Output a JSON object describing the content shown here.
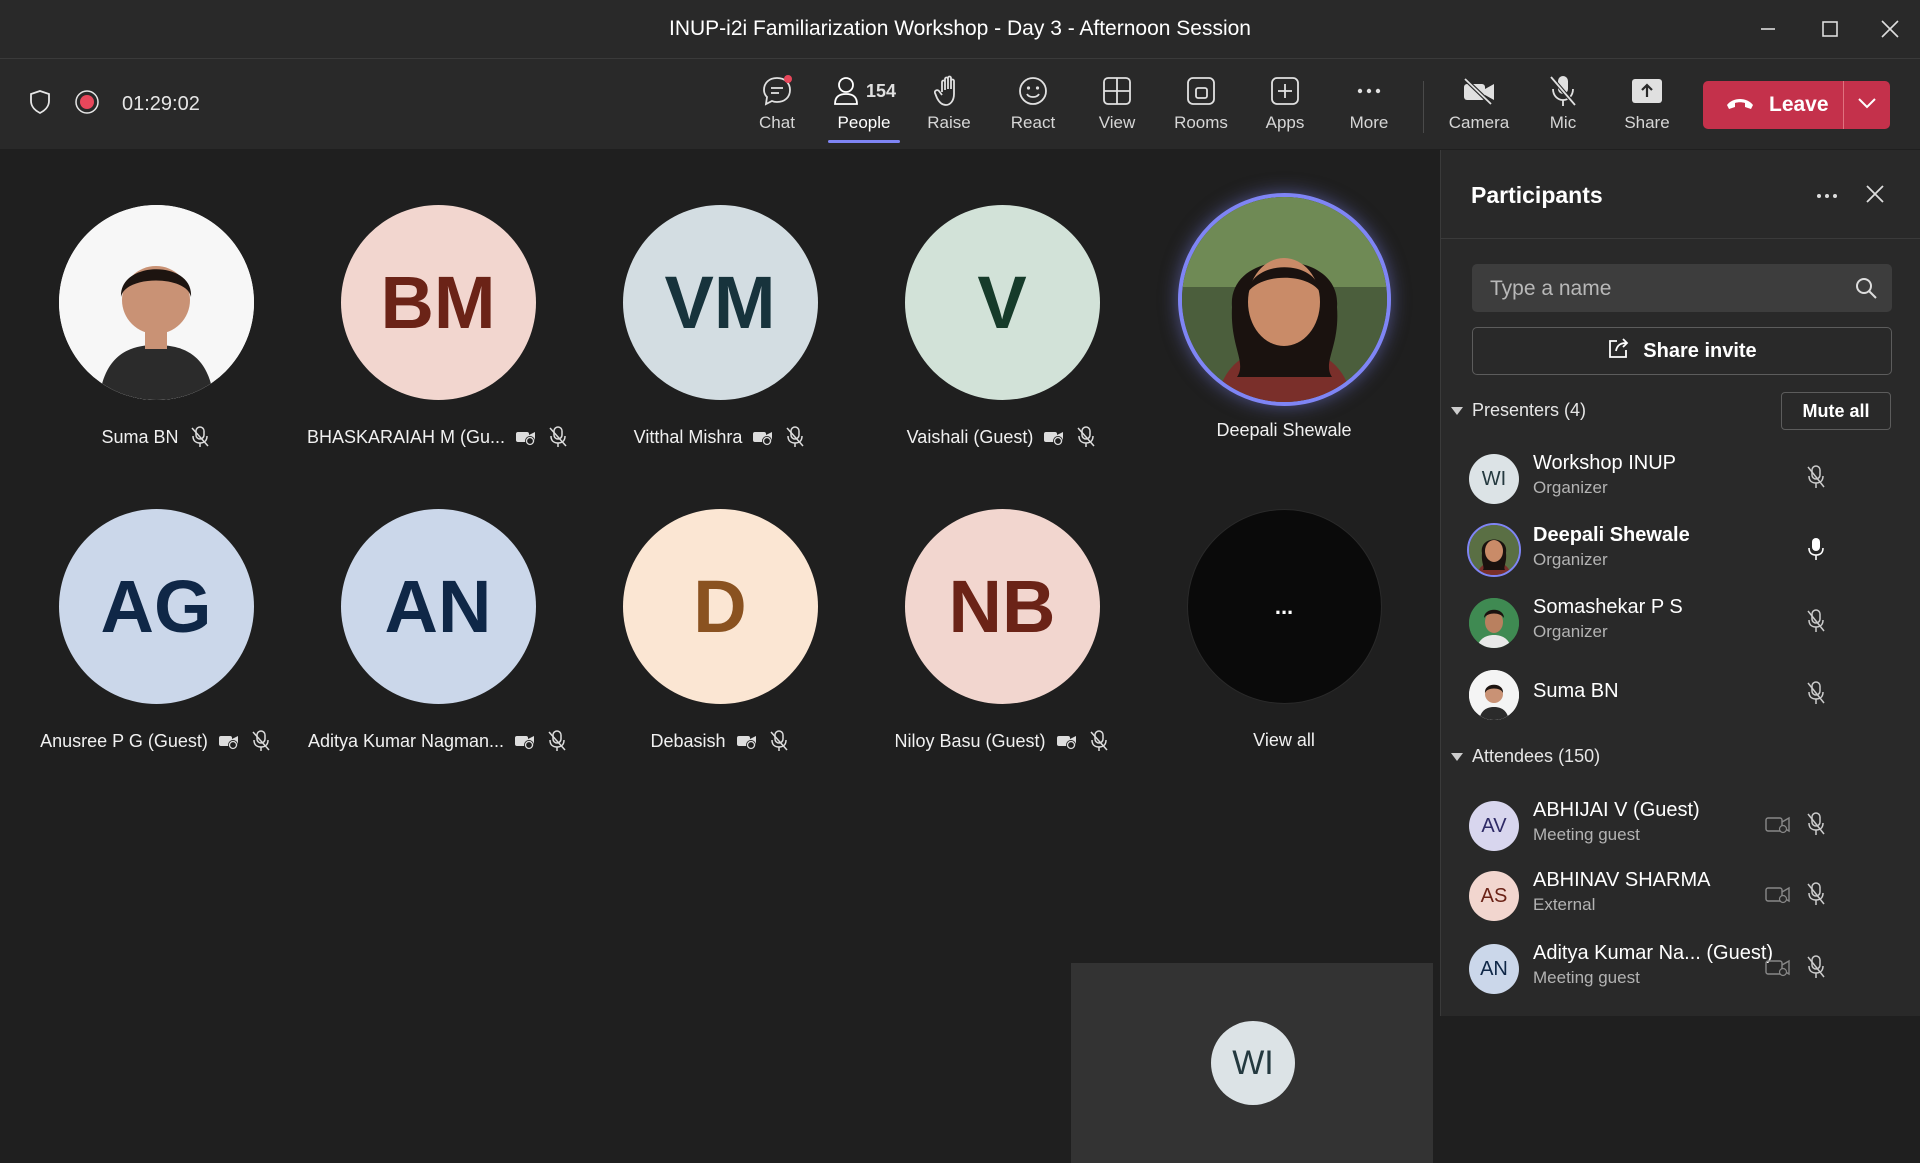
{
  "window": {
    "title": "INUP-i2i Familiarization Workshop - Day 3 - Afternoon Session"
  },
  "toolbar": {
    "timer": "01:29:02",
    "people_count": "154",
    "items": [
      {
        "label": "Chat",
        "icon": "chat-icon"
      },
      {
        "label": "People",
        "icon": "people-icon"
      },
      {
        "label": "Raise",
        "icon": "raise-hand-icon"
      },
      {
        "label": "React",
        "icon": "smiley-icon"
      },
      {
        "label": "View",
        "icon": "grid-icon"
      },
      {
        "label": "Rooms",
        "icon": "rooms-icon"
      },
      {
        "label": "Apps",
        "icon": "plus-box-icon"
      },
      {
        "label": "More",
        "icon": "more-icon"
      },
      {
        "label": "Camera",
        "icon": "camera-off-icon"
      },
      {
        "label": "Mic",
        "icon": "mic-off-icon"
      },
      {
        "label": "Share",
        "icon": "share-icon"
      }
    ],
    "leave_label": "Leave"
  },
  "stage": {
    "tiles": [
      {
        "name": "Suma BN",
        "initials": "",
        "bg": "#ffffff",
        "fg": "#333333",
        "photo": true,
        "cam_badge": false
      },
      {
        "name": "BHASKARAIAH M (Gu...",
        "initials": "BM",
        "bg": "#f2d6cf",
        "fg": "#6b2317",
        "photo": false,
        "cam_badge": true
      },
      {
        "name": "Vitthal Mishra",
        "initials": "VM",
        "bg": "#d3dde2",
        "fg": "#17333c",
        "photo": false,
        "cam_badge": true
      },
      {
        "name": "Vaishali (Guest)",
        "initials": "V",
        "bg": "#d2e2d8",
        "fg": "#163b2a",
        "photo": false,
        "cam_badge": true
      },
      {
        "name": "Deepali Shewale",
        "initials": "",
        "bg": "#3a4a3a",
        "fg": "#ffffff",
        "photo": true,
        "cam_badge": false
      },
      {
        "name": "Anusree P G (Guest)",
        "initials": "AG",
        "bg": "#cbd7ea",
        "fg": "#0f2747",
        "photo": false,
        "cam_badge": true
      },
      {
        "name": "Aditya Kumar Nagman...",
        "initials": "AN",
        "bg": "#cbd7ea",
        "fg": "#0f2747",
        "photo": false,
        "cam_badge": true
      },
      {
        "name": "Debasish",
        "initials": "D",
        "bg": "#fbe6d3",
        "fg": "#8a5220",
        "photo": false,
        "cam_badge": true
      },
      {
        "name": "Niloy Basu (Guest)",
        "initials": "NB",
        "bg": "#f2d6cf",
        "fg": "#6b2317",
        "photo": false,
        "cam_badge": true
      },
      {
        "name": "View all",
        "initials": "...",
        "bg": "#0a0a0a",
        "fg": "#ffffff",
        "photo": false,
        "cam_badge": false
      }
    ],
    "self_view_initials": "WI"
  },
  "panel": {
    "title": "Participants",
    "search_placeholder": "Type a name",
    "share_invite": "Share invite",
    "presenters_header": "Presenters (4)",
    "mute_all": "Mute all",
    "attendees_header": "Attendees (150)",
    "presenters": [
      {
        "initials": "WI",
        "name": "Workshop INUP",
        "role": "Organizer",
        "bg": "#dce3e6",
        "fg": "#24393f",
        "mic": "off"
      },
      {
        "initials": "",
        "name": "Deepali Shewale",
        "role": "Organizer",
        "bg": "#4a5a44",
        "fg": "#ffffff",
        "mic": "on"
      },
      {
        "initials": "",
        "name": "Somashekar P S",
        "role": "Organizer",
        "bg": "#3f7a4a",
        "fg": "#ffffff",
        "mic": "off"
      },
      {
        "initials": "",
        "name": "Suma BN",
        "role": "",
        "bg": "#ffffff",
        "fg": "#333333",
        "mic": "off"
      }
    ],
    "attendees": [
      {
        "initials": "AV",
        "name": "ABHIJAI V (Guest)",
        "role": "Meeting guest",
        "bg": "#d8d6ee",
        "fg": "#2e2a66"
      },
      {
        "initials": "AS",
        "name": "ABHINAV SHARMA",
        "role": "External",
        "bg": "#f2d6cf",
        "fg": "#6b2317"
      },
      {
        "initials": "AN",
        "name": "Aditya Kumar Na... (Guest)",
        "role": "Meeting guest",
        "bg": "#cbd7ea",
        "fg": "#0f2747"
      }
    ]
  }
}
